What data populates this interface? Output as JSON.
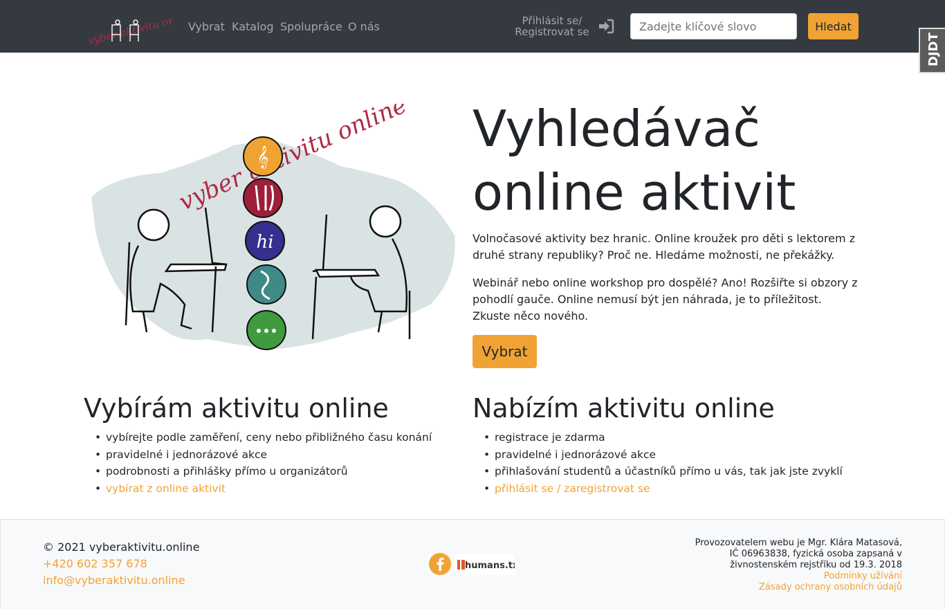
{
  "navbar": {
    "brand_alt": "vyber aktivitu online",
    "links": [
      "Vybrat",
      "Katalog",
      "Spolupráce",
      "O nás"
    ],
    "login_line1": "Přihlásit se/",
    "login_line2": "Registrovat se",
    "search_placeholder": "Zadejte klíčové slovo",
    "search_button": "Hledat"
  },
  "debug_toolbar": {
    "label": "DJDT"
  },
  "hero": {
    "illustration_text": "vyber aktivitu online",
    "title_line1": "Vyhledávač",
    "title_line2": "online aktivit",
    "paragraph1": "Volnočasové aktivity bez hranic. Online kroužek pro děti s lektorem z druhé strany republiky? Proč ne. Hledáme možnosti, ne překážky.",
    "paragraph2": "Webinář nebo online workshop pro dospělé? Ano! Rozšiřte si obzory z pohodlí gauče. Online nemusí být jen náhrada, je to příležitost. Zkuste něco nového.",
    "button": "Vybrat"
  },
  "columns": {
    "choose": {
      "title": "Vybírám aktivitu online",
      "items": [
        "vybírejte podle zaměření, ceny nebo přibližného času konání",
        "pravidelné i jednorázové akce",
        "podrobnosti a přihlášky přímo u organizátorů"
      ],
      "link": "vybírat z online aktivit"
    },
    "offer": {
      "title": "Nabízím aktivitu online",
      "items": [
        "registrace je zdarma",
        "pravidelné i jednorázové akce",
        "přihlašování studentů a účastníků přímo u vás, tak jak jste zvyklí"
      ],
      "link": "přihlásit se / zaregistrovat se"
    }
  },
  "footer": {
    "copyright": "© 2021 vyberaktivitu.online",
    "phone": "+420 602 357 678",
    "email": "info@vyberaktivitu.online",
    "humans_label": "humans.txt",
    "operator_line1": "Provozovatelem webu je Mgr. Klára Matasová,",
    "operator_line2": "IČ 06963838, fyzická osoba zapsaná v",
    "operator_line3": "živnostenském rejstříku od 19.3. 2018",
    "terms": "Podmínky užívání",
    "privacy": "Zásady ochrany osobních údajů"
  },
  "colors": {
    "accent": "#f0a334",
    "navbar": "#343a40",
    "brand_red": "#b02a45"
  }
}
